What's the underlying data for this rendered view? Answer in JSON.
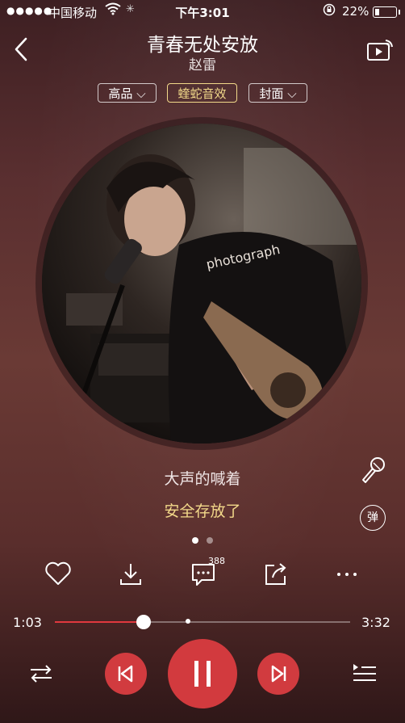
{
  "status_bar": {
    "signal": "●●●●●",
    "carrier": "中国移动",
    "time": "下午3:01",
    "battery_percent": "22%",
    "battery_level": 0.22
  },
  "header": {
    "title": "青春无处安放",
    "artist": "赵雷"
  },
  "chips": {
    "quality": "高品",
    "effect": "蝰蛇音效",
    "cover": "封面"
  },
  "lyrics": {
    "current": "大声的喊着",
    "next": "安全存放了"
  },
  "danmu_label": "弹",
  "actions": {
    "comment_count": "388"
  },
  "progress": {
    "current": "1:03",
    "total": "3:32",
    "played_fraction": 0.3,
    "buffered_fraction": 0.45
  },
  "pager": {
    "count": 2,
    "active": 0
  },
  "colors": {
    "accent": "#d13b3f",
    "lyric_highlight": "#f3d98a",
    "background": "#5a2f30"
  },
  "icons": [
    "back-icon",
    "cast-icon",
    "mic-icon",
    "heart-icon",
    "download-icon",
    "comment-icon",
    "share-icon",
    "more-icon",
    "shuffle-icon",
    "previous-icon",
    "pause-icon",
    "next-icon",
    "playlist-icon"
  ]
}
